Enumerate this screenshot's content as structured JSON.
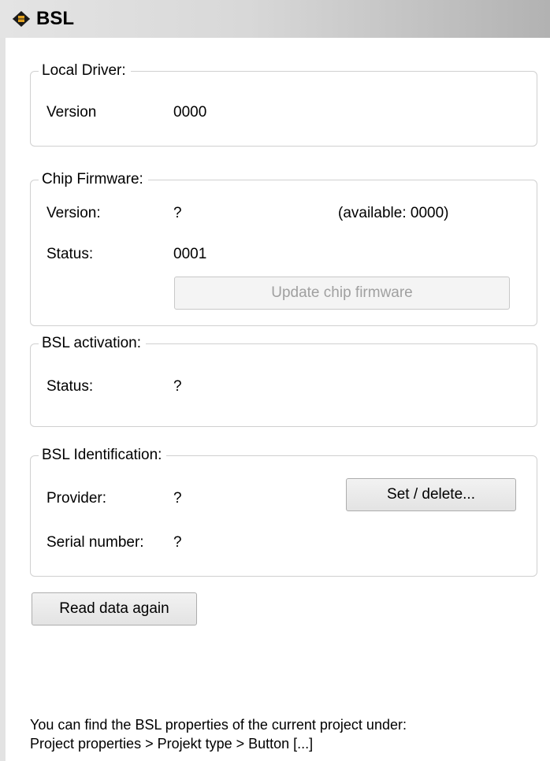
{
  "window": {
    "title": "BSL",
    "title_icon": "chip-icon"
  },
  "local_driver": {
    "legend": "Local Driver:",
    "version_label": "Version",
    "version_value": "0000"
  },
  "chip_firmware": {
    "legend": "Chip Firmware:",
    "version_label": "Version:",
    "version_value": "?",
    "available_text": "(available: 0000)",
    "status_label": "Status:",
    "status_value": "0001",
    "update_button": "Update chip firmware"
  },
  "bsl_activation": {
    "legend": "BSL activation:",
    "status_label": "Status:",
    "status_value": "?"
  },
  "bsl_identification": {
    "legend": "BSL Identification:",
    "provider_label": "Provider:",
    "provider_value": "?",
    "set_delete_button": "Set / delete...",
    "serial_label": "Serial number:",
    "serial_value": "?"
  },
  "read_again_button": "Read data again",
  "footer": {
    "line1": "You can find the BSL properties of the current project under:",
    "line2": "Project properties > Projekt type > Button [...]"
  }
}
